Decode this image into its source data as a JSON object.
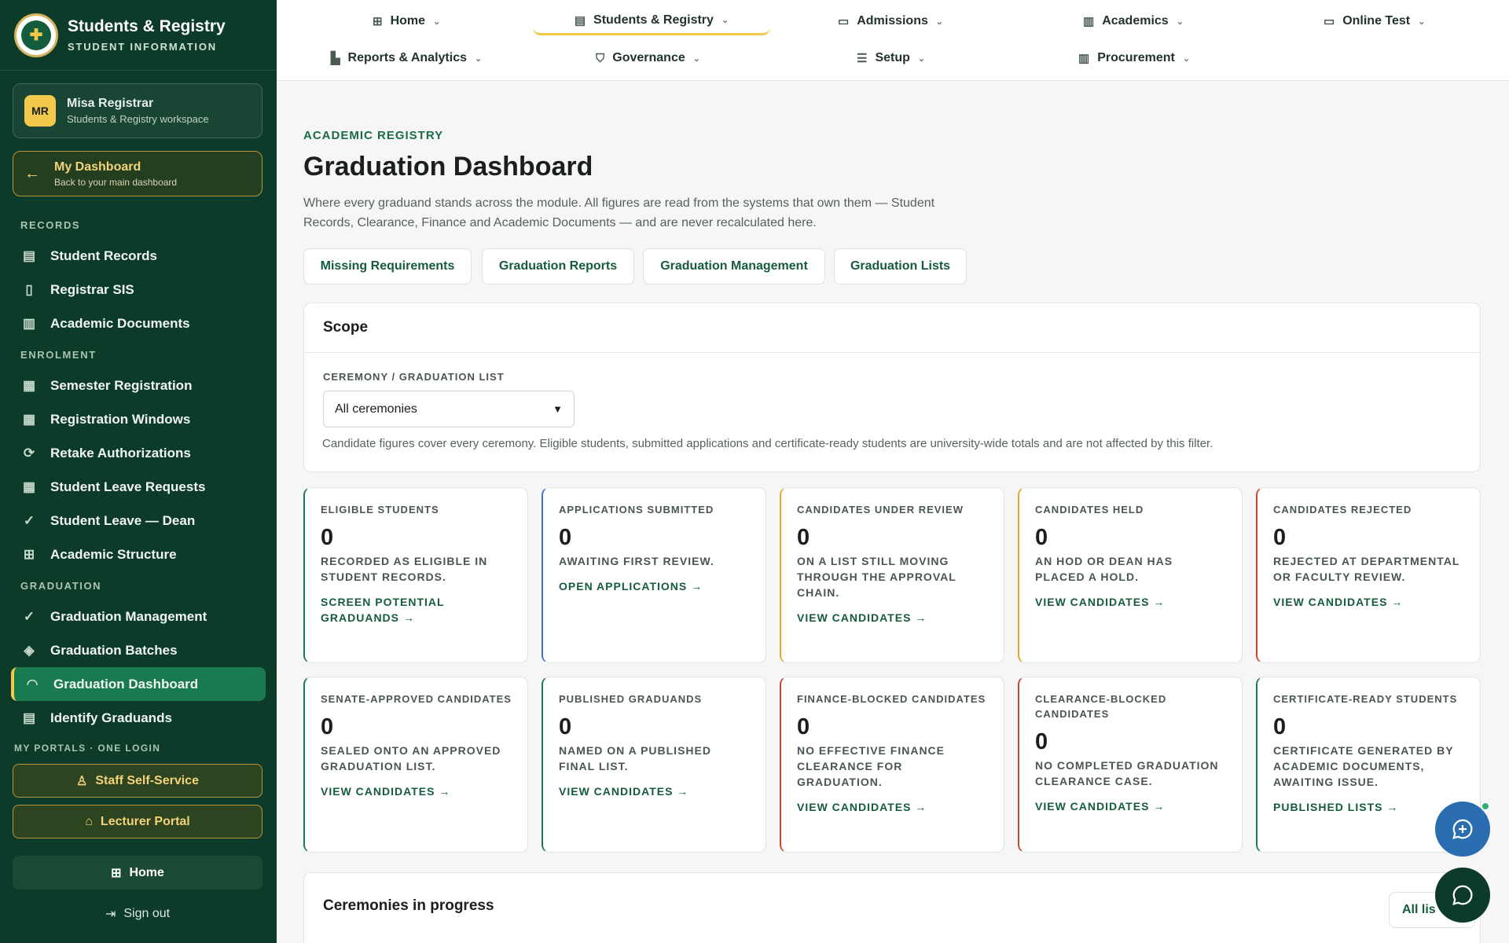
{
  "brand": {
    "title": "Students & Registry",
    "subtitle": "STUDENT INFORMATION",
    "logo_glyph": "✚"
  },
  "user": {
    "initials": "MR",
    "name": "Misa Registrar",
    "workspace": "Students & Registry workspace"
  },
  "dashboard_link": {
    "title": "My Dashboard",
    "subtitle": "Back to your main dashboard"
  },
  "sidebar": {
    "sections": [
      {
        "label": "RECORDS",
        "items": [
          {
            "label": "Student Records",
            "icon": "id-card-icon",
            "glyph": "▤"
          },
          {
            "label": "Registrar SIS",
            "icon": "book-icon",
            "glyph": "▯"
          },
          {
            "label": "Academic Documents",
            "icon": "document-icon",
            "glyph": "▥"
          }
        ]
      },
      {
        "label": "ENROLMENT",
        "items": [
          {
            "label": "Semester Registration",
            "icon": "calendar-check-icon",
            "glyph": "▦"
          },
          {
            "label": "Registration Windows",
            "icon": "calendar-icon",
            "glyph": "▦"
          },
          {
            "label": "Retake Authorizations",
            "icon": "refresh-icon",
            "glyph": "⟳"
          },
          {
            "label": "Student Leave Requests",
            "icon": "calendar-icon",
            "glyph": "▦"
          },
          {
            "label": "Student Leave — Dean",
            "icon": "check-circle-icon",
            "glyph": "✓"
          },
          {
            "label": "Academic Structure",
            "icon": "hierarchy-icon",
            "glyph": "⊞"
          }
        ]
      },
      {
        "label": "GRADUATION",
        "items": [
          {
            "label": "Graduation Management",
            "icon": "check-circle-icon",
            "glyph": "✓"
          },
          {
            "label": "Graduation Batches",
            "icon": "layers-icon",
            "glyph": "◈"
          },
          {
            "label": "Graduation Dashboard",
            "icon": "gauge-icon",
            "glyph": "◠",
            "active": true
          },
          {
            "label": "Identify Graduands",
            "icon": "id-card-icon",
            "glyph": "▤"
          }
        ]
      }
    ],
    "portals_label": "MY PORTALS · ONE LOGIN",
    "portals": [
      {
        "label": "Staff Self-Service",
        "icon": "user-icon",
        "glyph": "♙"
      },
      {
        "label": "Lecturer Portal",
        "icon": "graduation-cap-icon",
        "glyph": "⌂"
      }
    ],
    "home": {
      "label": "Home",
      "glyph": "⊞"
    },
    "signout": {
      "label": "Sign out",
      "glyph": "⇥"
    }
  },
  "topnav": [
    {
      "label": "Home",
      "icon": "grid-icon",
      "glyph": "⊞"
    },
    {
      "label": "Students & Registry",
      "icon": "id-card-icon",
      "glyph": "▤",
      "active": true
    },
    {
      "label": "Admissions",
      "icon": "inbox-icon",
      "glyph": "▭"
    },
    {
      "label": "Academics",
      "icon": "clipboard-icon",
      "glyph": "▥"
    },
    {
      "label": "Online Test",
      "icon": "monitor-icon",
      "glyph": "▭"
    },
    {
      "label": "Reports & Analytics",
      "icon": "bar-chart-icon",
      "glyph": "▙"
    },
    {
      "label": "Governance",
      "icon": "shield-icon",
      "glyph": "⛉"
    },
    {
      "label": "Setup",
      "icon": "sliders-icon",
      "glyph": "☰"
    },
    {
      "label": "Procurement",
      "icon": "clipboard-icon",
      "glyph": "▥"
    }
  ],
  "page": {
    "eyebrow": "ACADEMIC REGISTRY",
    "title": "Graduation Dashboard",
    "description": "Where every graduand stands across the module. All figures are read from the systems that own them — Student Records, Clearance, Finance and Academic Documents — and are never recalculated here.",
    "quick_links": [
      "Missing Requirements",
      "Graduation Reports",
      "Graduation Management",
      "Graduation Lists"
    ]
  },
  "scope": {
    "title": "Scope",
    "field_label": "CEREMONY / GRADUATION LIST",
    "selected": "All ceremonies",
    "note": "Candidate figures cover every ceremony. Eligible students, submitted applications and certificate-ready students are university-wide totals and are not affected by this filter."
  },
  "stats": [
    {
      "label": "Eligible Students",
      "value": "0",
      "desc": "Recorded as eligible in Student Records.",
      "link": "Screen potential graduands →",
      "accent": "#1a7a4f"
    },
    {
      "label": "Applications Submitted",
      "value": "0",
      "desc": "Awaiting first review.",
      "link": "Open applications →",
      "accent": "#3b6fd8"
    },
    {
      "label": "Candidates Under Review",
      "value": "0",
      "desc": "On a list still moving through the approval chain.",
      "link": "View candidates →",
      "accent": "#e0a830"
    },
    {
      "label": "Candidates Held",
      "value": "0",
      "desc": "An HOD or Dean has placed a hold.",
      "link": "View candidates →",
      "accent": "#e0a830"
    },
    {
      "label": "Candidates Rejected",
      "value": "0",
      "desc": "Rejected at departmental or faculty review.",
      "link": "View candidates →",
      "accent": "#c8452f"
    },
    {
      "label": "Senate-Approved Candidates",
      "value": "0",
      "desc": "Sealed onto an approved graduation list.",
      "link": "View candidates →",
      "accent": "#1a7a4f"
    },
    {
      "label": "Published Graduands",
      "value": "0",
      "desc": "Named on a published final list.",
      "link": "View candidates →",
      "accent": "#1a7a4f"
    },
    {
      "label": "Finance-Blocked Candidates",
      "value": "0",
      "desc": "No effective finance clearance for graduation.",
      "link": "View candidates →",
      "accent": "#c8452f"
    },
    {
      "label": "Clearance-Blocked Candidates",
      "value": "0",
      "desc": "No completed graduation clearance case.",
      "link": "View candidates →",
      "accent": "#c8452f"
    },
    {
      "label": "Certificate-Ready Students",
      "value": "0",
      "desc": "Certificate generated by Academic Documents, awaiting issue.",
      "link": "Published lists →",
      "accent": "#1a7a4f"
    }
  ],
  "ceremonies": {
    "title": "Ceremonies in progress",
    "button": "All lis"
  },
  "colors": {
    "sidebar_bg": "#0d3b2a",
    "accent_gold": "#f3c94b",
    "primary_green": "#155c3c",
    "active_nav": "#1a7a4f",
    "fab_blue": "#2a6db0",
    "fab_green": "#0d3b2a"
  }
}
